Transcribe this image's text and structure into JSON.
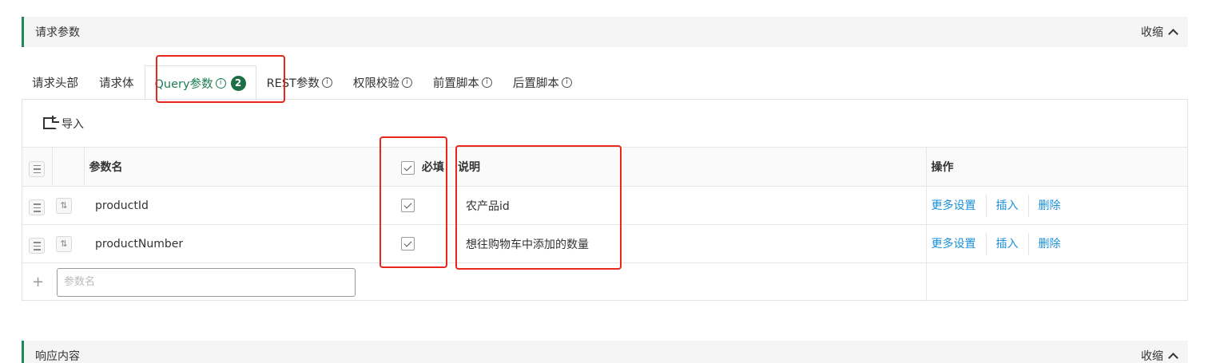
{
  "request_section": {
    "title": "请求参数",
    "collapse_label": "收缩"
  },
  "tabs": [
    {
      "label": "请求头部",
      "has_info": false
    },
    {
      "label": "请求体",
      "has_info": false
    },
    {
      "label": "Query参数",
      "has_info": true,
      "badge": "2",
      "active": true
    },
    {
      "label": "REST参数",
      "has_info": true
    },
    {
      "label": "权限校验",
      "has_info": true
    },
    {
      "label": "前置脚本",
      "has_info": true
    },
    {
      "label": "后置脚本",
      "has_info": true
    }
  ],
  "info_glyph": "i",
  "toolbar": {
    "import_label": "导入"
  },
  "table": {
    "headers": {
      "name": "参数名",
      "required": "必填",
      "description": "说明",
      "actions": "操作"
    },
    "rows": [
      {
        "name": "productId",
        "required": true,
        "description": "农产品id"
      },
      {
        "name": "productNumber",
        "required": true,
        "description": "想往购物车中添加的数量"
      }
    ],
    "action_labels": {
      "more": "更多设置",
      "insert": "插入",
      "delete": "删除"
    },
    "new_row": {
      "plus": "+",
      "placeholder": "参数名"
    }
  },
  "response_section": {
    "title": "响应内容",
    "collapse_label": "收缩"
  },
  "colors": {
    "accent": "#1e7d53",
    "link": "#1a8fd8",
    "highlight": "#e8281e"
  }
}
